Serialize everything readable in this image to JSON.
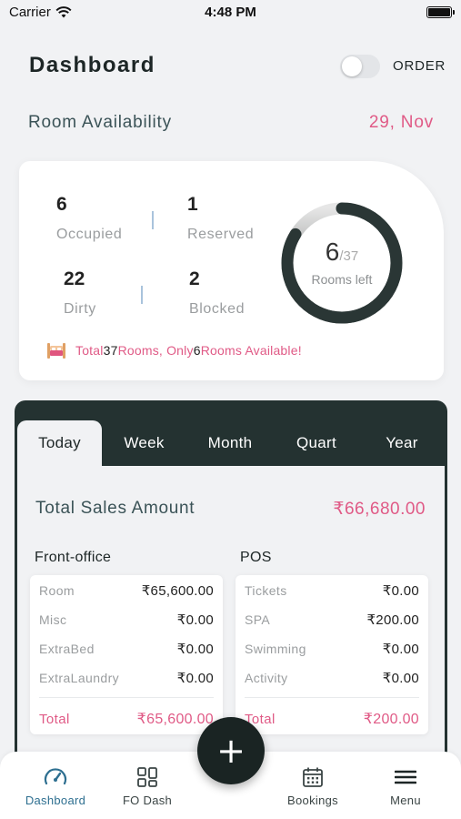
{
  "status_bar": {
    "carrier": "Carrier",
    "time": "4:48 PM"
  },
  "header": {
    "title": "Dashboard",
    "toggle_label": "ORDER",
    "toggle_on": false
  },
  "room_availability": {
    "title": "Room Availability",
    "date": "29, Nov",
    "stats": [
      {
        "value": "6",
        "label": "Occupied"
      },
      {
        "value": "1",
        "label": "Reserved"
      },
      {
        "value": "22",
        "label": "Dirty"
      },
      {
        "value": "2",
        "label": "Blocked"
      }
    ],
    "ring": {
      "left": "6",
      "total": "/37",
      "label": "Rooms left",
      "fraction_left": 0.162
    },
    "summary": {
      "prefix": "Total ",
      "total": "37",
      "middle": " Rooms, Only ",
      "available": "6",
      "suffix": " Rooms Available!"
    },
    "colors": {
      "accent_pink": "#e05a86",
      "ring_dark": "#2a3635"
    }
  },
  "sales": {
    "tabs": [
      "Today",
      "Week",
      "Month",
      "Quart",
      "Year"
    ],
    "active_tab": "Today",
    "total_label": "Total Sales Amount",
    "total_value": "₹66,680.00",
    "front_office": {
      "title": "Front-office",
      "rows": [
        {
          "label": "Room",
          "value": "₹65,600.00"
        },
        {
          "label": "Misc",
          "value": "₹0.00"
        },
        {
          "label": "ExtraBed",
          "value": "₹0.00"
        },
        {
          "label": "ExtraLaundry",
          "value": "₹0.00"
        }
      ],
      "total_label": "Total",
      "total_value": "₹65,600.00"
    },
    "pos": {
      "title": "POS",
      "rows": [
        {
          "label": "Tickets",
          "value": "₹0.00"
        },
        {
          "label": "SPA",
          "value": "₹200.00"
        },
        {
          "label": "Swimming",
          "value": "₹0.00"
        },
        {
          "label": "Activity",
          "value": "₹0.00"
        }
      ],
      "total_label": "Total",
      "total_value": "₹200.00"
    }
  },
  "bottom_nav": {
    "items": [
      {
        "label": "Dashboard",
        "icon": "speedometer-icon"
      },
      {
        "label": "FO Dash",
        "icon": "grid-icon"
      },
      {
        "label": "Bookings",
        "icon": "calendar-icon"
      },
      {
        "label": "Menu",
        "icon": "hamburger-menu-icon"
      }
    ],
    "active": "Dashboard",
    "fab_icon": "plus-icon"
  }
}
